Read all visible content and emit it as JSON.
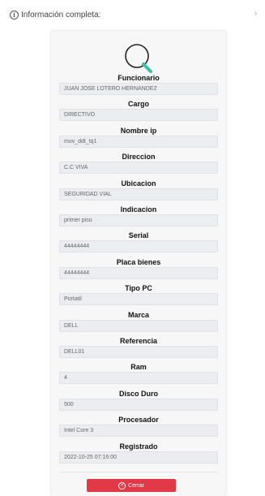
{
  "header": {
    "title": "Información completa:",
    "info_icon": "i",
    "close_glyph": "›"
  },
  "fields": [
    {
      "label": "Funcionario",
      "value": "JUAN JOSE LOTERO HERNANDEZ"
    },
    {
      "label": "Cargo",
      "value": "DIRECTIVO"
    },
    {
      "label": "Nombre ip",
      "value": "mov_ddt_tq1"
    },
    {
      "label": "Direccion",
      "value": "C.C VIVA"
    },
    {
      "label": "Ubicacion",
      "value": "SEGURIDAD VIAL"
    },
    {
      "label": "Indicacion",
      "value": "primer piso"
    },
    {
      "label": "Serial",
      "value": "44444444"
    },
    {
      "label": "Placa bienes",
      "value": "44444444"
    },
    {
      "label": "Tipo PC",
      "value": "Portatil"
    },
    {
      "label": "Marca",
      "value": "DELL"
    },
    {
      "label": "Referencia",
      "value": "DELL01"
    },
    {
      "label": "Ram",
      "value": "4"
    },
    {
      "label": "Disco Duro",
      "value": "500"
    },
    {
      "label": "Procesador",
      "value": "Intel Core 3"
    },
    {
      "label": "Registrado",
      "value": "2022-10-25 07:16:00"
    }
  ],
  "footer": {
    "close_label": "Cerrar",
    "close_icon": "x-circle-icon"
  },
  "colors": {
    "accent_red": "#e13a46",
    "search_icon_teal": "#3cbfae"
  }
}
